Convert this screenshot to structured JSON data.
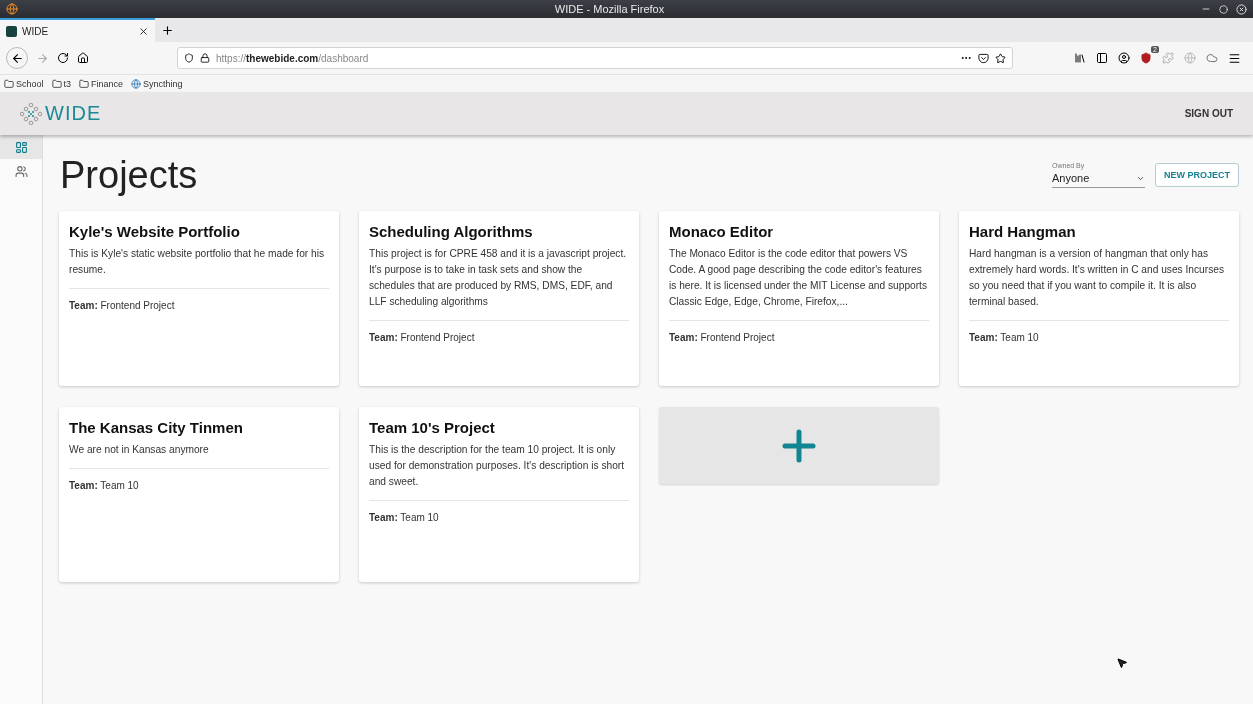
{
  "window": {
    "title": "WIDE - Mozilla Firefox"
  },
  "browser": {
    "tabs": [
      {
        "label": "WIDE",
        "selected": true
      }
    ],
    "url_host": "thewebide.com",
    "url_prefix": "https://",
    "url_path": "/dashboard",
    "extension_badge": "2",
    "bookmarks": [
      {
        "label": "School",
        "kind": "folder"
      },
      {
        "label": "t3",
        "kind": "folder"
      },
      {
        "label": "Finance",
        "kind": "folder"
      },
      {
        "label": "Syncthing",
        "kind": "site"
      }
    ]
  },
  "app": {
    "logo": "WIDE",
    "sign_out": "SIGN OUT"
  },
  "sidebar": {
    "items": [
      {
        "kind": "dashboard",
        "selected": true
      },
      {
        "kind": "people",
        "selected": false
      }
    ]
  },
  "page": {
    "title": "Projects",
    "filter": {
      "label": "Owned By",
      "value": "Anyone"
    },
    "new_button": "NEW PROJECT"
  },
  "projects": [
    {
      "name": "Kyle's Website Portfolio",
      "description": "This is Kyle's static website portfolio that he made for his resume.",
      "team_label": "Team:",
      "team": "Frontend Project"
    },
    {
      "name": "Scheduling Algorithms",
      "description": "This project is for CPRE 458 and it is a javascript project. It's purpose is to take in task sets and show the schedules that are produced by RMS, DMS, EDF, and LLF scheduling algorithms",
      "team_label": "Team:",
      "team": "Frontend Project"
    },
    {
      "name": "Monaco Editor",
      "description": "The Monaco Editor is the code editor that powers VS Code. A good page describing the code editor's features is here. It is licensed under the MIT License and supports Classic Edge, Edge, Chrome, Firefox,...",
      "team_label": "Team:",
      "team": "Frontend Project"
    },
    {
      "name": "Hard Hangman",
      "description": "Hard hangman is a version of hangman that only has extremely hard words. It's written in C and uses Incurses so you need that if you want to compile it. It is also terminal based.",
      "team_label": "Team:",
      "team": "Team 10"
    },
    {
      "name": "The Kansas City Tinmen",
      "description": "We are not in Kansas anymore",
      "team_label": "Team:",
      "team": "Team 10"
    },
    {
      "name": "Team 10's Project",
      "description": "This is the description for the team 10 project. It is only used for demonstration purposes. It's description is short and sweet.",
      "team_label": "Team:",
      "team": "Team 10"
    }
  ]
}
